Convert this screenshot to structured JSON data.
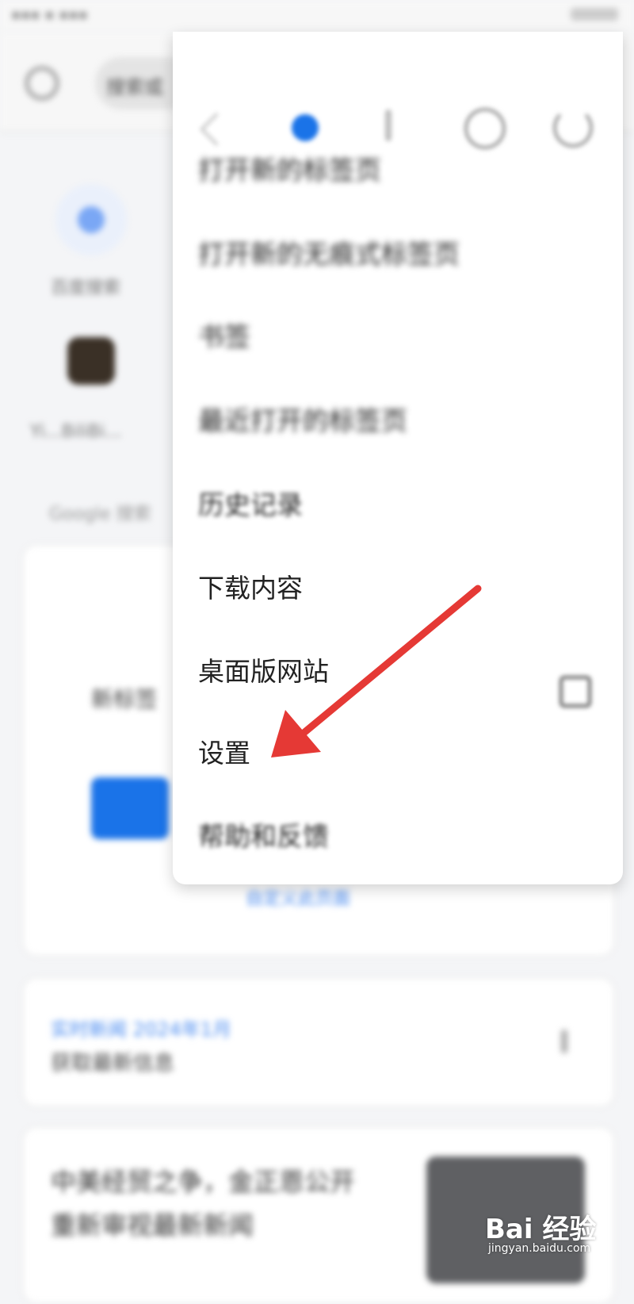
{
  "menu": {
    "items": [
      {
        "label": "打开新的标签页"
      },
      {
        "label": "打开新的无痕式标签页"
      },
      {
        "label": "书签"
      },
      {
        "label": "最近打开的标签页"
      },
      {
        "label": "历史记录"
      },
      {
        "label": "下载内容"
      },
      {
        "label": "桌面版网站"
      },
      {
        "label": "设置"
      },
      {
        "label": "帮助和反馈"
      }
    ],
    "desktop_site_checked": false
  },
  "toolbar": {
    "omnibox_text": "搜索或"
  },
  "page": {
    "shortcut_labels": [
      "百度搜索",
      "Yi...BiliBi..."
    ],
    "section_label": "Google 搜索",
    "card_title": "新标签",
    "link_text": "自定义此页面",
    "news_source": "实时新闻 2024年1月",
    "news_title": "获取最新信息",
    "article_text_1": "中美经贸之争，金正恩公开",
    "article_text_2": "重新审视最新新闻"
  },
  "watermark": {
    "brand": "Bai 经验",
    "url": "jingyan.baidu.com"
  },
  "colors": {
    "accent": "#1a73e8",
    "arrow": "#e53935"
  }
}
